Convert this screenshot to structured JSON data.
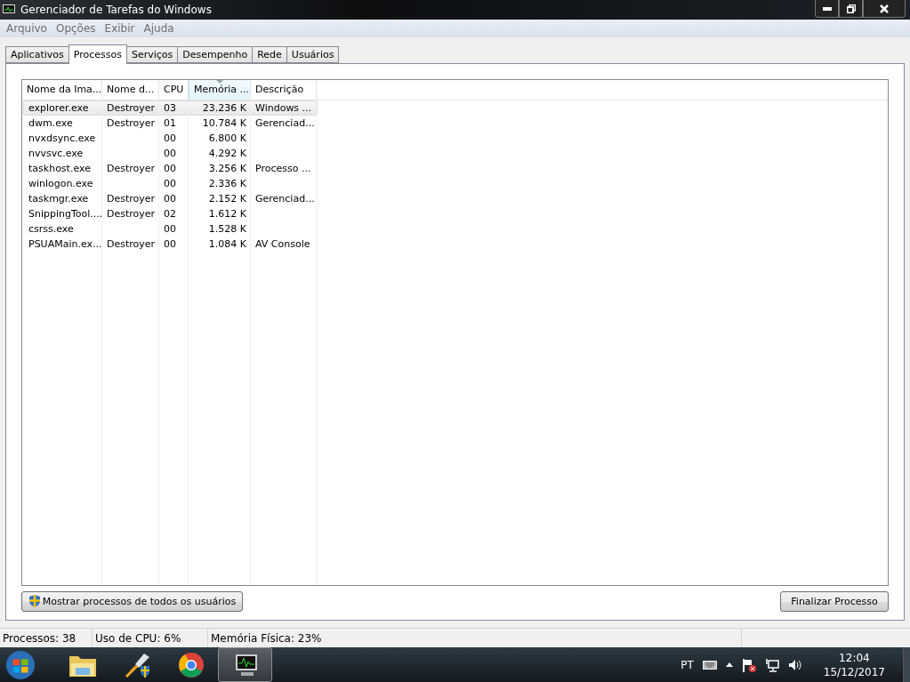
{
  "window": {
    "title": "Gerenciador de Tarefas do Windows"
  },
  "menu": [
    "Arquivo",
    "Opções",
    "Exibir",
    "Ajuda"
  ],
  "tabs": [
    {
      "label": "Aplicativos",
      "selected": false
    },
    {
      "label": "Processos",
      "selected": true
    },
    {
      "label": "Serviços",
      "selected": false
    },
    {
      "label": "Desempenho",
      "selected": false
    },
    {
      "label": "Rede",
      "selected": false
    },
    {
      "label": "Usuários",
      "selected": false
    }
  ],
  "table": {
    "columns": [
      {
        "label": "Nome da Ima...",
        "sorted": false
      },
      {
        "label": "Nome d...",
        "sorted": false
      },
      {
        "label": "CPU",
        "sorted": false
      },
      {
        "label": "Memória ...",
        "sorted": true
      },
      {
        "label": "Descrição",
        "sorted": false
      }
    ],
    "rows": [
      {
        "cells": [
          "explorer.exe",
          "Destroyer",
          "03",
          "23.236 K",
          "Windows ..."
        ],
        "selected": true
      },
      {
        "cells": [
          "dwm.exe",
          "Destroyer",
          "01",
          "10.784 K",
          "Gerenciad..."
        ],
        "selected": false
      },
      {
        "cells": [
          "nvxdsync.exe",
          "",
          "00",
          "6.800 K",
          ""
        ],
        "selected": false
      },
      {
        "cells": [
          "nvvsvc.exe",
          "",
          "00",
          "4.292 K",
          ""
        ],
        "selected": false
      },
      {
        "cells": [
          "taskhost.exe",
          "Destroyer",
          "00",
          "3.256 K",
          "Processo ..."
        ],
        "selected": false
      },
      {
        "cells": [
          "winlogon.exe",
          "",
          "00",
          "2.336 K",
          ""
        ],
        "selected": false
      },
      {
        "cells": [
          "taskmgr.exe",
          "Destroyer",
          "00",
          "2.152 K",
          "Gerenciad..."
        ],
        "selected": false
      },
      {
        "cells": [
          "SnippingTool....",
          "Destroyer",
          "02",
          "1.612 K",
          ""
        ],
        "selected": false
      },
      {
        "cells": [
          "csrss.exe",
          "",
          "00",
          "1.528 K",
          ""
        ],
        "selected": false
      },
      {
        "cells": [
          "PSUAMain.ex...",
          "Destroyer",
          "00",
          "1.084 K",
          "AV Console"
        ],
        "selected": false
      }
    ]
  },
  "buttons": {
    "show_all": "Mostrar processos de todos os usuários",
    "end_process": "Finalizar Processo"
  },
  "status_bar": [
    "Processos: 38",
    "Uso de CPU: 6%",
    "Memória Física: 23%"
  ],
  "taskbar": {
    "apps": [
      {
        "kind": "folder",
        "selected": false
      },
      {
        "kind": "rocket",
        "selected": false
      },
      {
        "kind": "browser",
        "selected": false
      },
      {
        "kind": "monitor",
        "selected": true
      }
    ],
    "language": "PT",
    "time": "12:04",
    "date": "15/12/2017"
  }
}
